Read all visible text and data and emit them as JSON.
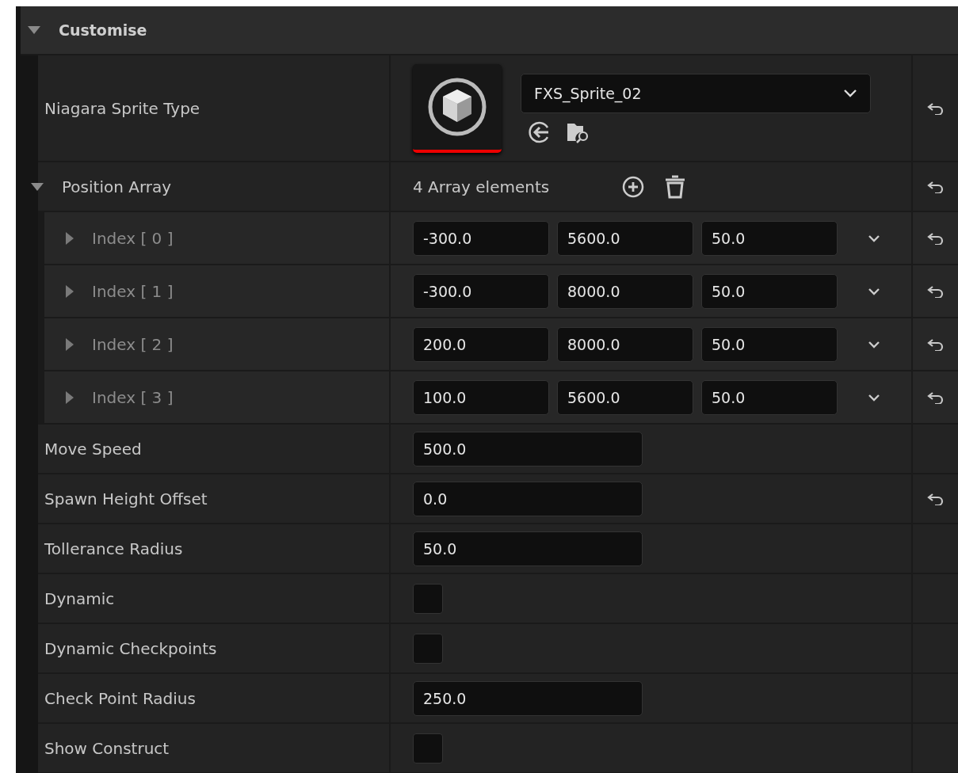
{
  "section": {
    "title": "Customise",
    "expanded": true
  },
  "properties": [
    {
      "kind": "asset",
      "name": "Niagara Sprite Type",
      "value": "FXS_Sprite_02",
      "reset": true
    },
    {
      "kind": "array",
      "name": "Position Array",
      "expanded": true,
      "count": "4 Array elements",
      "reset": true,
      "children": [
        {
          "name": "Index [ 0 ]",
          "expanded": false,
          "values": [
            "-300.0",
            "5600.0",
            "50.0"
          ],
          "reset": true
        },
        {
          "name": "Index [ 1 ]",
          "expanded": false,
          "values": [
            "-300.0",
            "8000.0",
            "50.0"
          ],
          "reset": true
        },
        {
          "name": "Index [ 2 ]",
          "expanded": false,
          "values": [
            "200.0",
            "8000.0",
            "50.0"
          ],
          "reset": true
        },
        {
          "name": "Index [ 3 ]",
          "expanded": false,
          "values": [
            "100.0",
            "5600.0",
            "50.0"
          ],
          "reset": true
        }
      ]
    },
    {
      "kind": "number",
      "name": "Move Speed",
      "value": "500.0",
      "reset": false
    },
    {
      "kind": "number",
      "name": "Spawn Height Offset",
      "value": "0.0",
      "reset": true
    },
    {
      "kind": "number",
      "name": "Tollerance Radius",
      "value": "50.0",
      "reset": false
    },
    {
      "kind": "checkbox",
      "name": "Dynamic",
      "checked": false,
      "reset": false
    },
    {
      "kind": "checkbox",
      "name": "Dynamic Checkpoints",
      "checked": false,
      "reset": false
    },
    {
      "kind": "number",
      "name": "Check Point Radius",
      "value": "250.0",
      "reset": false
    },
    {
      "kind": "checkbox",
      "name": "Show Construct",
      "checked": false,
      "reset": false
    }
  ]
}
